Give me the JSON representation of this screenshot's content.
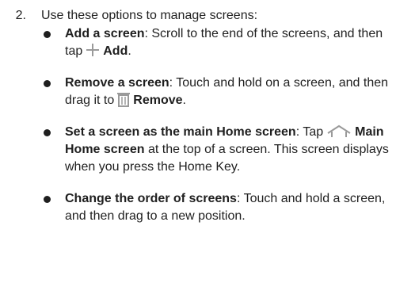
{
  "step": {
    "number": "2.",
    "text": "Use these options to manage screens:"
  },
  "options": [
    {
      "title": "Add a screen",
      "sep": ": ",
      "text_before": "Scroll to the end of the screens, and then tap",
      "icon": "plus-icon",
      "ui_label": "Add",
      "text_after": "."
    },
    {
      "title": "Remove a screen",
      "sep": ": ",
      "text_before": "Touch and hold on a screen, and then drag it to",
      "icon": "trash-icon",
      "ui_label": "Remove",
      "text_after": "."
    },
    {
      "title": "Set a screen as the main Home screen",
      "sep": ": ",
      "text_before": "Tap",
      "icon": "home-icon",
      "ui_label": "Main Home screen",
      "text_after": "at the top of a screen. This screen displays when you press the Home Key."
    },
    {
      "title": "Change the order of screens",
      "sep": ": ",
      "text_before": "Touch and hold a screen, and then drag to a new position.",
      "icon": "",
      "ui_label": "",
      "text_after": ""
    }
  ],
  "colors": {
    "text": "#1f1f1f",
    "icon": "#9a9a9a"
  }
}
